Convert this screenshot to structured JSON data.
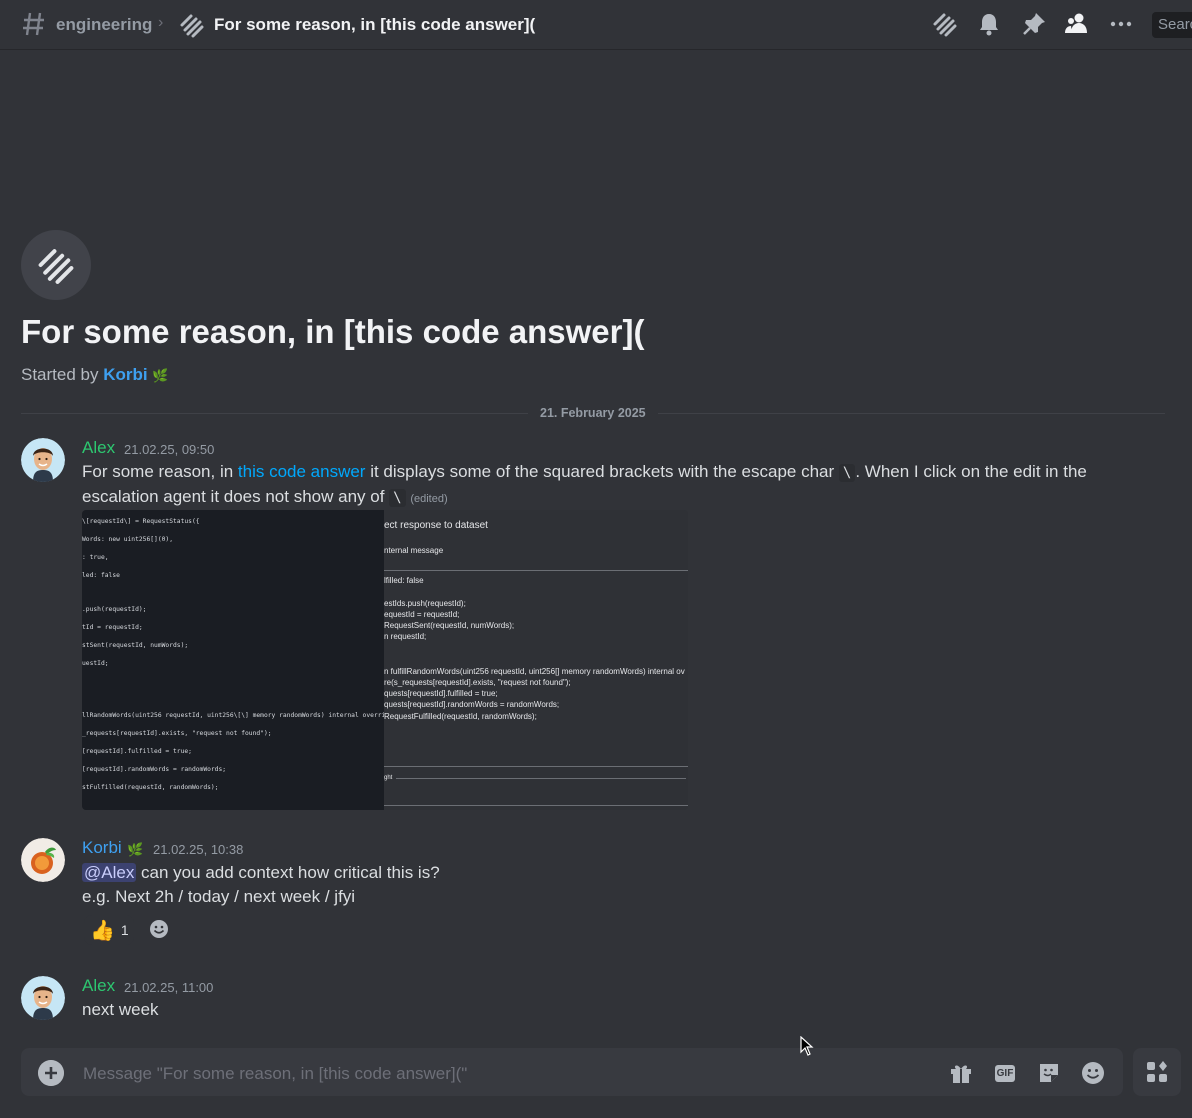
{
  "header": {
    "channel": "engineering",
    "thread_title": "For some reason, in [this code answer](",
    "search_placeholder": "Search"
  },
  "thread": {
    "title": "For some reason, in [this code answer](",
    "started_by_label": "Started by",
    "started_by_user": "Korbi"
  },
  "date_divider": "21. February 2025",
  "messages": [
    {
      "author": "Alex",
      "author_color": "#2dc770",
      "timestamp": "21.02.25, 09:50",
      "text_part1": "For some reason, in ",
      "link": "this code answer",
      "text_part2": " it displays some of the squared brackets with the escape char ",
      "code1": "\\",
      "text_part3": ". When I click on the edit in the escalation agent it does not show any of ",
      "code2": "\\",
      "edited": "(edited)"
    },
    {
      "author": "Korbi",
      "author_color": "#3ea0f0",
      "timestamp": "21.02.25, 10:38",
      "mention": "@Alex",
      "line1": " can you add context how critical this is?",
      "line2": "e.g. Next 2h / today / next week / jfyi",
      "reaction_emoji": "👍",
      "reaction_count": "1"
    },
    {
      "author": "Alex",
      "author_color": "#2dc770",
      "timestamp": "21.02.25, 11:00",
      "text": "next week"
    }
  ],
  "attachment": {
    "code_lines": [
      "\\[requestId\\] = RequestStatus({",
      "Words: new uint256[](0),",
      ": true,",
      "led: false",
      ".push(requestId);",
      "tId = requestId;",
      "stSent(requestId, numWords);",
      "uestId;",
      "llRandomWords(uint256 requestId, uint256\\[\\] memory randomWords) internal override {",
      "_requests[requestId].exists, \"request not found\");",
      "[requestId].fulfilled = true;",
      "[requestId].randomWords = randomWords;",
      "stFulfilled(requestId, randomWords);"
    ],
    "preview_lines": [
      "ect response to dataset",
      "nternal message",
      "lfilled: false",
      "estIds.push(requestId);",
      "equestId = requestId;",
      "RequestSent(requestId, numWords);",
      "n requestId;",
      "n fulfillRandomWords(uint256 requestId, uint256[] memory randomWords) internal ov",
      "re(s_requests[requestId].exists, \"request not found\");",
      "quests[requestId].fulfilled = true;",
      "quests[requestId].randomWords = randomWords;",
      "RequestFulfilled(requestId, randomWords);",
      "ght"
    ]
  },
  "composer": {
    "placeholder": "Message \"For some reason, in [this code answer](\"",
    "gif_label": "GIF"
  }
}
